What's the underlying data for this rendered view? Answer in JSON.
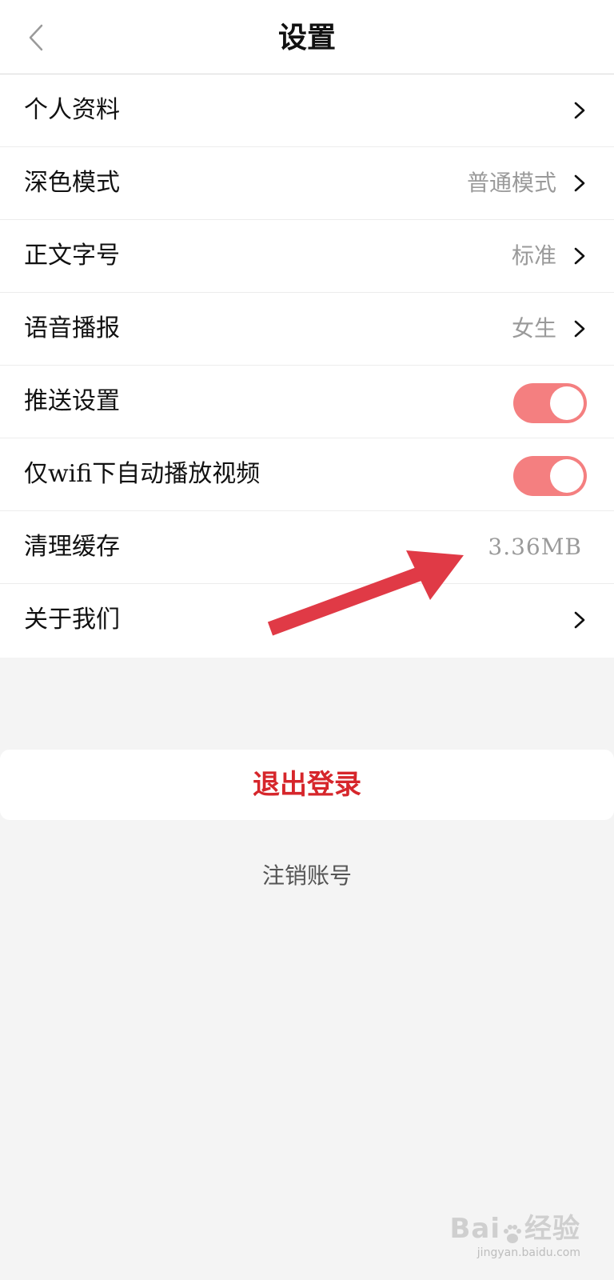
{
  "header": {
    "title": "设置",
    "back_icon": "chevron-left-icon"
  },
  "settings": {
    "items": [
      {
        "label": "个人资料",
        "value": "",
        "control": "chevron"
      },
      {
        "label": "深色模式",
        "value": "普通模式",
        "control": "chevron"
      },
      {
        "label": "正文字号",
        "value": "标准",
        "control": "chevron"
      },
      {
        "label": "语音播报",
        "value": "女生",
        "control": "chevron"
      },
      {
        "label": "推送设置",
        "toggle_on": true,
        "control": "toggle"
      },
      {
        "label": "仅wifi下自动播放视频",
        "toggle_on": true,
        "control": "toggle"
      },
      {
        "label": "清理缓存",
        "value": "3.36MB",
        "control": "none"
      },
      {
        "label": "关于我们",
        "value": "",
        "control": "chevron"
      }
    ]
  },
  "logout": {
    "label": "退出登录"
  },
  "cancel_account": {
    "label": "注销账号"
  },
  "watermark": {
    "logo": "Bai",
    "logo_tail": "经验",
    "sub": "jingyan.baidu.com"
  },
  "colors": {
    "accent_red": "#d6262b",
    "toggle_on": "#f47f80",
    "annotation_arrow": "#e03a46",
    "background": "#f4f4f4"
  }
}
